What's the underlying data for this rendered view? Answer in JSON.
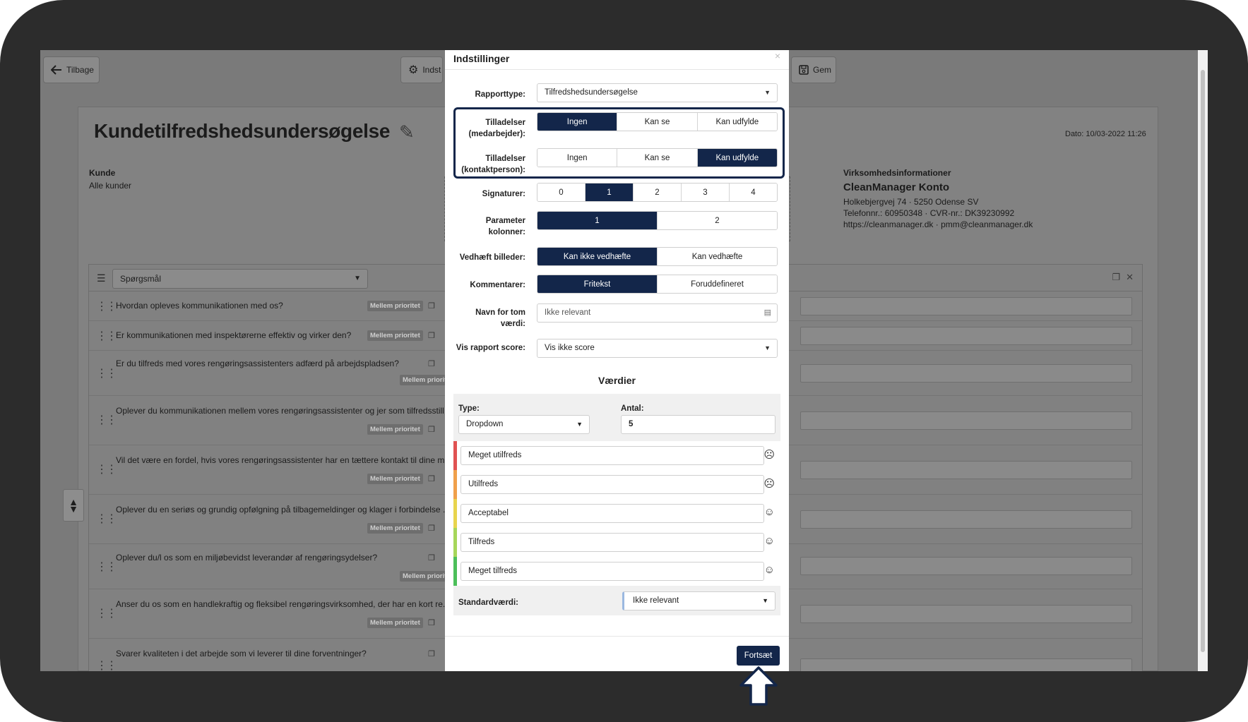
{
  "topbar": {
    "back_label": "Tilbage",
    "settings_label": "Indst",
    "save_label": "Gem"
  },
  "page": {
    "title": "Kundetilfredshedsundersøgelse",
    "date": "Dato: 10/03-2022 11:26",
    "kunde_label": "Kunde",
    "kunde_value": "Alle kunder",
    "company_label": "Virksomhedsinformationer",
    "company_name": "CleanManager Konto",
    "company_address": "Holkebjergvej 74 · 5250 Odense SV",
    "company_phone": "Telefonnr.: 60950348 · CVR-nr.: DK39230992",
    "company_web": "https://cleanmanager.dk · pmm@cleanmanager.dk"
  },
  "questions": {
    "select_value": "Spørgsmål",
    "badge": "Mellem prioritet",
    "items": [
      "Hvordan opleves kommunikationen med os?",
      "Er kommunikationen med inspektørerne effektiv og virker den?",
      "Er du tilfreds med vores rengøringsassistenters adfærd på arbejdspladsen?",
      "Oplever du kommunikationen mellem vores rengøringsassistenter og jer som tilfredsstill...",
      "Vil det være en fordel, hvis vores rengøringsassistenter har en tættere kontakt til dine m...",
      "Oplever du en seriøs og grundig opfølgning på tilbagemeldinger og klager i forbindelse ...",
      "Oplever du/l os som en miljøbevidst leverandør af rengøringsydelser?",
      "Anser du os som en handlekraftig og fleksibel rengøringsvirksomhed, der har en kort re...",
      "Svarer kvaliteten i det arbejde som vi leverer til dine forventninger?"
    ]
  },
  "modal": {
    "title": "Indstillinger",
    "close": "×",
    "rapporttype_label": "Rapporttype:",
    "rapporttype_value": "Tilfredshedsundersøgelse",
    "tilladelser_med_label": "Tilladelser (medarbejder):",
    "tilladelser_kon_label": "Tilladelser (kontaktperson):",
    "perm_options": [
      "Ingen",
      "Kan se",
      "Kan udfylde"
    ],
    "perm_medarbejder_selected": "Ingen",
    "perm_kontaktperson_selected": "Kan udfylde",
    "signaturer_label": "Signaturer:",
    "signaturer_options": [
      "0",
      "1",
      "2",
      "3",
      "4"
    ],
    "signaturer_selected": "1",
    "parameter_label": "Parameter kolonner:",
    "parameter_options": [
      "1",
      "2"
    ],
    "parameter_selected": "1",
    "billeder_label": "Vedhæft billeder:",
    "billeder_options": [
      "Kan ikke vedhæfte",
      "Kan vedhæfte"
    ],
    "billeder_selected": "Kan ikke vedhæfte",
    "kommentarer_label": "Kommentarer:",
    "kommentarer_options": [
      "Fritekst",
      "Foruddefineret"
    ],
    "kommentarer_selected": "Fritekst",
    "navn_label": "Navn for tom værdi:",
    "navn_value": "Ikke relevant",
    "score_label": "Vis rapport score:",
    "score_value": "Vis ikke score",
    "vaerdier_title": "Værdier",
    "type_label": "Type:",
    "type_value": "Dropdown",
    "antal_label": "Antal:",
    "antal_value": "5",
    "values": [
      {
        "label": "Meget utilfreds",
        "color": "#e05252"
      },
      {
        "label": "Utilfreds",
        "color": "#f0a04b"
      },
      {
        "label": "Acceptabel",
        "color": "#e8d44d"
      },
      {
        "label": "Tilfreds",
        "color": "#a6d65a"
      },
      {
        "label": "Meget tilfreds",
        "color": "#4cbf5a"
      }
    ],
    "standard_label": "Standardværdi:",
    "standard_value": "Ikke relevant",
    "continue_label": "Fortsæt"
  },
  "colors": {
    "accent": "#13264a",
    "overlay": "#7a7a7a"
  }
}
